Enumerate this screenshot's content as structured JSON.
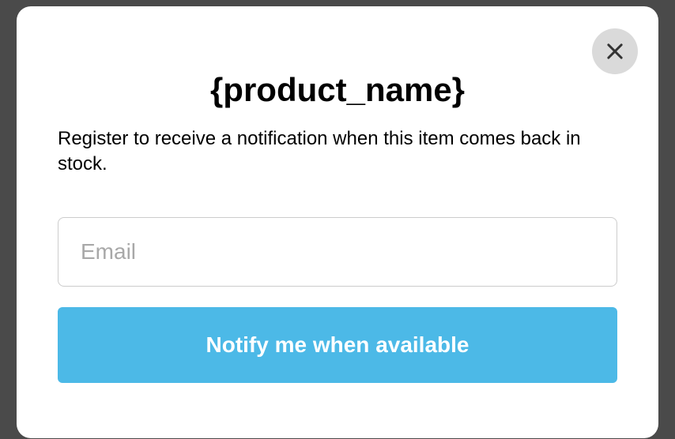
{
  "modal": {
    "title": "{product_name}",
    "description": "Register to receive a notification when this item comes back in stock.",
    "email_placeholder": "Email",
    "notify_button_label": "Notify me when available"
  }
}
